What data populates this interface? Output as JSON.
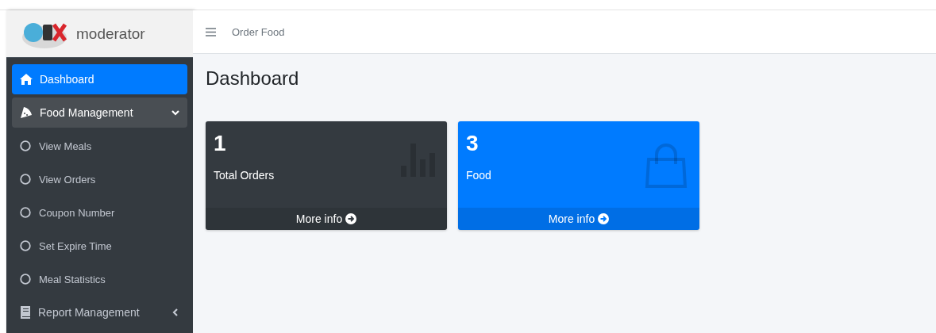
{
  "brand": {
    "name": "moderator"
  },
  "topbar": {
    "title": "Order Food"
  },
  "sidebar": {
    "items": [
      {
        "kind": "link",
        "label": "Dashboard",
        "selected": true
      },
      {
        "kind": "group",
        "label": "Food Management",
        "expanded": true,
        "selected": false,
        "children": [
          {
            "label": "View Meals",
            "selected": false
          },
          {
            "label": "View Orders",
            "selected": false
          },
          {
            "label": "Coupon Number",
            "selected": false
          },
          {
            "label": "Set Expire Time",
            "selected": false
          },
          {
            "label": "Meal Statistics",
            "selected": false
          }
        ]
      },
      {
        "kind": "group",
        "label": "Report Management",
        "expanded": false,
        "selected": false
      }
    ]
  },
  "page": {
    "title": "Dashboard"
  },
  "cards": [
    {
      "value": "1",
      "label": "Total Orders",
      "link": "More info",
      "color": "#343a40"
    },
    {
      "value": "3",
      "label": "Food",
      "link": "More info",
      "color": "#007bff"
    }
  ]
}
